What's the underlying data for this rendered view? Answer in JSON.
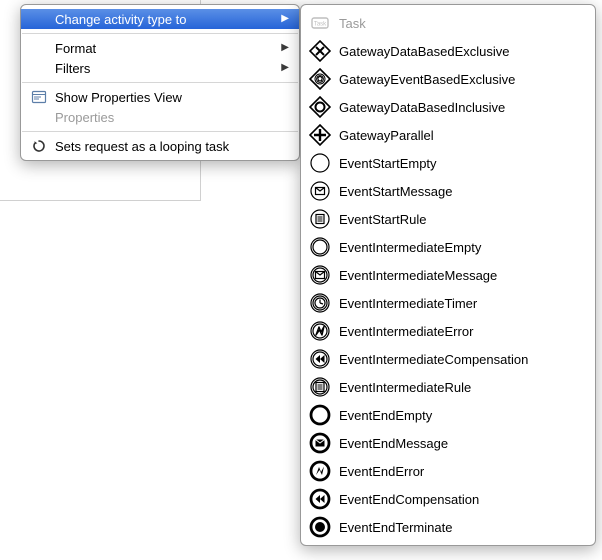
{
  "main_menu": {
    "change_activity": "Change activity type to",
    "format": "Format",
    "filters": "Filters",
    "show_properties": "Show Properties View",
    "properties": "Properties",
    "sets_looping": "Sets request as a looping task"
  },
  "submenu": {
    "items": [
      {
        "id": "task",
        "label": "Task"
      },
      {
        "id": "gateway-data-exclusive",
        "label": "GatewayDataBasedExclusive"
      },
      {
        "id": "gateway-event-exclusive",
        "label": "GatewayEventBasedExclusive"
      },
      {
        "id": "gateway-data-inclusive",
        "label": "GatewayDataBasedInclusive"
      },
      {
        "id": "gateway-parallel",
        "label": "GatewayParallel"
      },
      {
        "id": "event-start-empty",
        "label": "EventStartEmpty"
      },
      {
        "id": "event-start-message",
        "label": "EventStartMessage"
      },
      {
        "id": "event-start-rule",
        "label": "EventStartRule"
      },
      {
        "id": "event-intermediate-empty",
        "label": "EventIntermediateEmpty"
      },
      {
        "id": "event-intermediate-message",
        "label": "EventIntermediateMessage"
      },
      {
        "id": "event-intermediate-timer",
        "label": "EventIntermediateTimer"
      },
      {
        "id": "event-intermediate-error",
        "label": "EventIntermediateError"
      },
      {
        "id": "event-intermediate-compensation",
        "label": "EventIntermediateCompensation"
      },
      {
        "id": "event-intermediate-rule",
        "label": "EventIntermediateRule"
      },
      {
        "id": "event-end-empty",
        "label": "EventEndEmpty"
      },
      {
        "id": "event-end-message",
        "label": "EventEndMessage"
      },
      {
        "id": "event-end-error",
        "label": "EventEndError"
      },
      {
        "id": "event-end-compensation",
        "label": "EventEndCompensation"
      },
      {
        "id": "event-end-terminate",
        "label": "EventEndTerminate"
      }
    ]
  }
}
